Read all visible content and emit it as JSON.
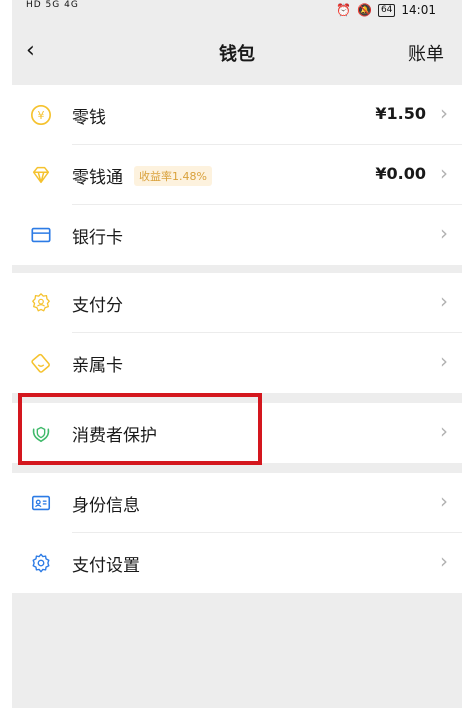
{
  "status_bar": {
    "left": "HD 5G 4G",
    "time": "14:01",
    "battery": "64"
  },
  "nav": {
    "back_icon": "chevron-left-icon",
    "title": "钱包",
    "bill": "账单"
  },
  "groups": [
    {
      "items": [
        {
          "label": "零钱",
          "amount": "¥1.50",
          "icon": "yen-coin-icon"
        },
        {
          "label": "零钱通",
          "badge": "收益率1.48%",
          "amount": "¥0.00",
          "icon": "diamond-icon"
        },
        {
          "label": "银行卡",
          "icon": "card-icon"
        }
      ]
    },
    {
      "items": [
        {
          "label": "支付分",
          "icon": "score-icon"
        },
        {
          "label": "亲属卡",
          "icon": "family-card-icon"
        }
      ]
    },
    {
      "items": [
        {
          "label": "消费者保护",
          "icon": "protect-icon"
        }
      ]
    },
    {
      "items": [
        {
          "label": "身份信息",
          "icon": "id-card-icon"
        },
        {
          "label": "支付设置",
          "icon": "settings-icon"
        }
      ]
    }
  ],
  "colors": {
    "accent": "#d4171e",
    "gold": "#f5c22e",
    "blue": "#2c7be5",
    "green": "#3fb96a"
  }
}
